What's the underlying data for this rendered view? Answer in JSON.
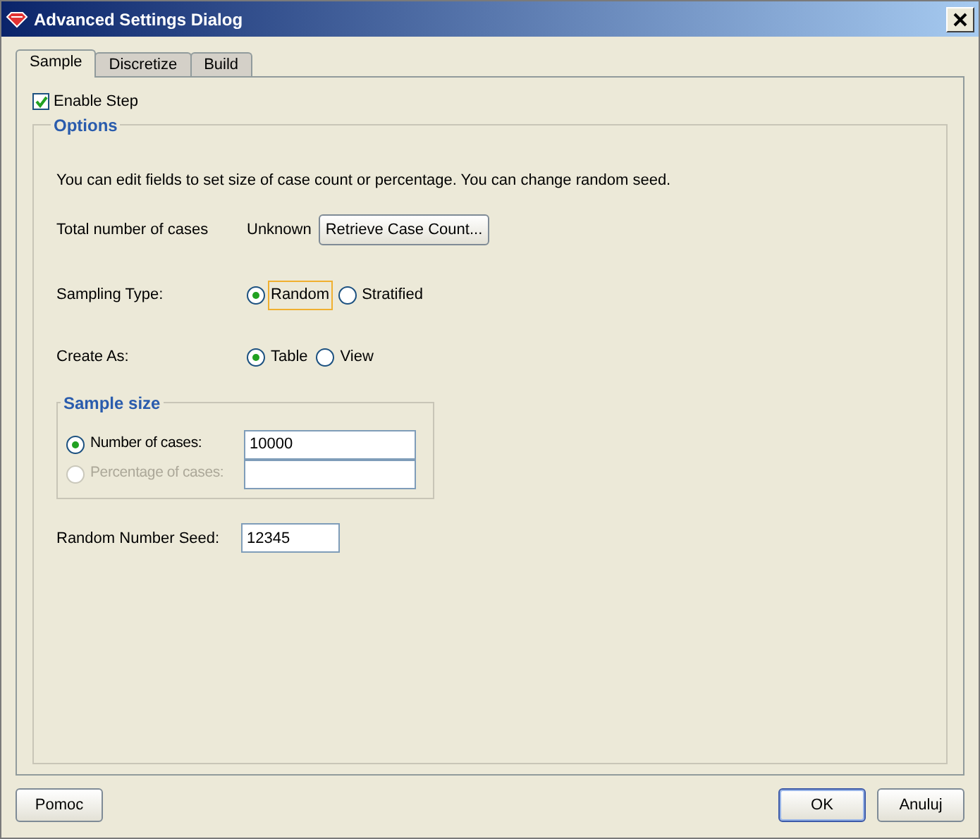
{
  "window": {
    "title": "Advanced Settings Dialog"
  },
  "tabs": [
    {
      "label": "Sample",
      "selected": true
    },
    {
      "label": "Discretize",
      "selected": false
    },
    {
      "label": "Build",
      "selected": false
    }
  ],
  "enable_step": {
    "label": "Enable Step",
    "checked": true
  },
  "options": {
    "title": "Options",
    "description": "You can edit fields to set size of case count or percentage. You can change random seed.",
    "total_cases": {
      "label": "Total number of cases",
      "value": "Unknown",
      "button": "Retrieve Case Count..."
    },
    "sampling_type": {
      "label": "Sampling Type:",
      "choices": [
        {
          "label": "Random",
          "selected": true,
          "focused": true
        },
        {
          "label": "Stratified",
          "selected": false,
          "focused": false
        }
      ]
    },
    "create_as": {
      "label": "Create As:",
      "choices": [
        {
          "label": "Table",
          "selected": true,
          "focused": false
        },
        {
          "label": "View",
          "selected": false,
          "focused": false
        }
      ]
    },
    "sample_size": {
      "title": "Sample size",
      "choices": [
        {
          "label": "Number of cases:",
          "selected": true,
          "disabled": false,
          "value": "10000"
        },
        {
          "label": "Percentage of cases:",
          "selected": false,
          "disabled": true
        }
      ]
    },
    "seed": {
      "label": "Random Number Seed:",
      "value": "12345"
    }
  },
  "buttons": [
    {
      "label": "Pomoc",
      "kind": "help",
      "default": false
    },
    {
      "label": "OK",
      "kind": "action",
      "default": true
    },
    {
      "label": "Anuluj",
      "kind": "action",
      "default": false
    }
  ]
}
